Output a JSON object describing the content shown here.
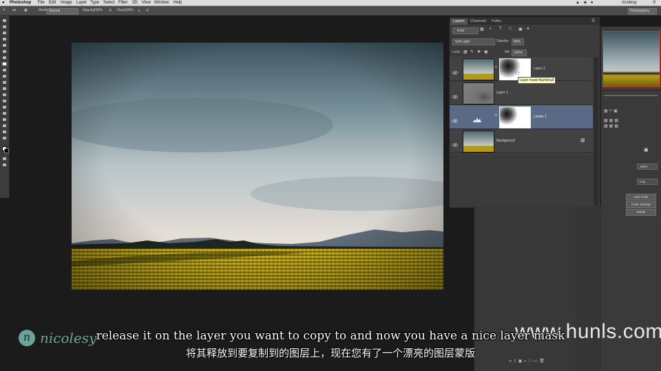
{
  "menubar": {
    "items": [
      "Photoshop",
      "File",
      "Edit",
      "Image",
      "Layer",
      "Type",
      "Select",
      "Filter",
      "3D",
      "View",
      "Window",
      "Help"
    ],
    "user": "nicolesy"
  },
  "options_bar": {
    "mode_label": "Mode:",
    "mode_value": "Normal",
    "opacity_label": "Opacity:",
    "opacity_value": "100%",
    "flow_label": "Flow:",
    "flow_value": "100%",
    "workspace": "Photography"
  },
  "layers_panel": {
    "tabs": [
      "Layers",
      "Channels",
      "Paths"
    ],
    "filter_kind": "Kind",
    "blend_mode": "Soft Light",
    "opacity_label": "Opacity:",
    "opacity_value": "80%",
    "lock_label": "Lock:",
    "fill_label": "Fill:",
    "fill_value": "100%",
    "layers": [
      {
        "name": "Layer 2",
        "has_mask": true
      },
      {
        "name": "Layer 1",
        "has_mask": false
      },
      {
        "name": "Levels 1",
        "has_mask": true,
        "selected": true
      },
      {
        "name": "Background",
        "locked": true
      }
    ],
    "tooltip": "Layer mask thumbnail"
  },
  "right_panel": {
    "buttons": [
      "Auto Color",
      "Color Settings",
      "Delete"
    ],
    "value_1": "100%",
    "value_2": "0 px"
  },
  "captions": {
    "english": "release it on the layer you want to copy to and now you have a nice layer mask",
    "chinese": "将其释放到要复制到的图层上，现在您有了一个漂亮的图层蒙版"
  },
  "watermark": "www.hunls.com",
  "logo": {
    "initial": "n",
    "text": "nicolesy"
  },
  "colors": {
    "panel_bg": "#3b3b3b",
    "selected_layer": "#596a86",
    "caption_text": "#ffffff",
    "logo": "#6aa59a"
  }
}
